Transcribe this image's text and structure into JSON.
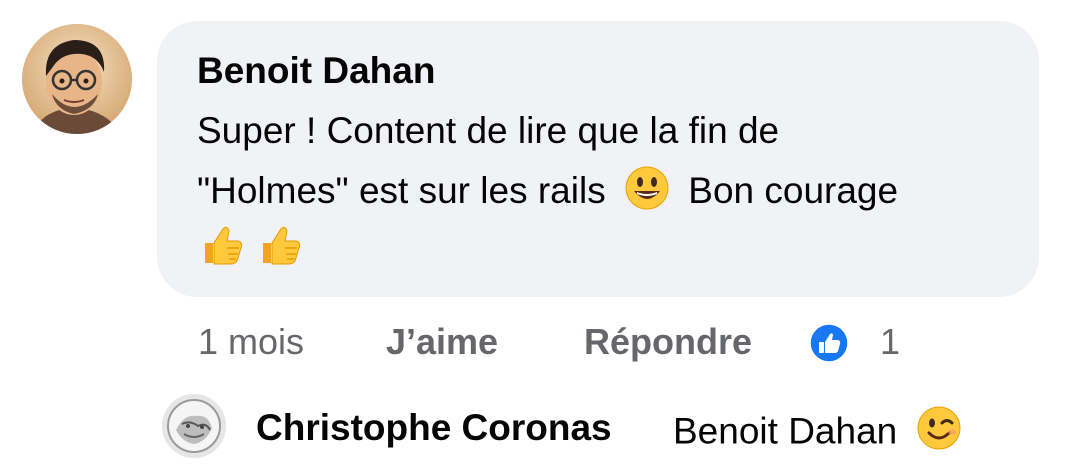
{
  "comment": {
    "author": "Benoit Dahan",
    "text_line1": "Super ! Content de lire que la fin de",
    "text_line2_before_emoji": "\"Holmes\" est sur les rails",
    "text_line2_after_emoji": "Bon courage",
    "emoji_inline": "smiling-face-icon",
    "emoji_line3": [
      "thumbs-up-icon",
      "thumbs-up-icon"
    ],
    "time": "1 mois",
    "like_label": "J’aime",
    "reply_label": "Répondre",
    "reaction_icon": "like-reaction-icon",
    "reaction_count": "1"
  },
  "reply": {
    "author": "Christophe Coronas",
    "text": "Benoit Dahan",
    "emoji": "winking-face-icon"
  },
  "colors": {
    "bubble_bg": "#f0f2f5",
    "muted_text": "#65676b",
    "like_blue": "#1877f2",
    "emoji_yellow": "#ffc83d"
  }
}
